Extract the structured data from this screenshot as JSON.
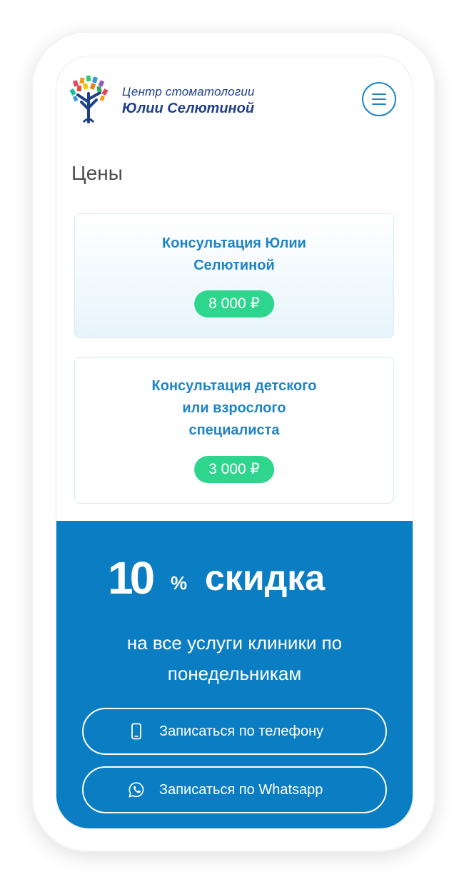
{
  "header": {
    "logo_line1": "Центр стоматологии",
    "logo_line2": "Юлии Селютиной",
    "logo_icon": "tree-logo",
    "menu_icon": "hamburger-icon"
  },
  "page": {
    "title": "Цены"
  },
  "prices": [
    {
      "title_lines": [
        "Консультация Юлии",
        "Селютиной"
      ],
      "price": "8 000 ₽"
    },
    {
      "title_lines": [
        "Консультация детского",
        "или взрослого",
        "специалиста"
      ],
      "price": "3 000 ₽"
    }
  ],
  "promo": {
    "number": "10",
    "percent": "%",
    "word": "скидка",
    "subtitle_lines": [
      "на все услуги клиники по",
      "понедельникам"
    ]
  },
  "buttons": {
    "phone": {
      "label": "Записаться по телефону",
      "icon": "phone-icon"
    },
    "whatsapp": {
      "label": "Записаться по Whatsapp",
      "icon": "whatsapp-icon"
    }
  },
  "colors": {
    "brand_blue": "#1f84c6",
    "promo_bg": "#0b7ec3",
    "price_green": "#2ed58d",
    "logo_navy": "#1e3f8a"
  }
}
